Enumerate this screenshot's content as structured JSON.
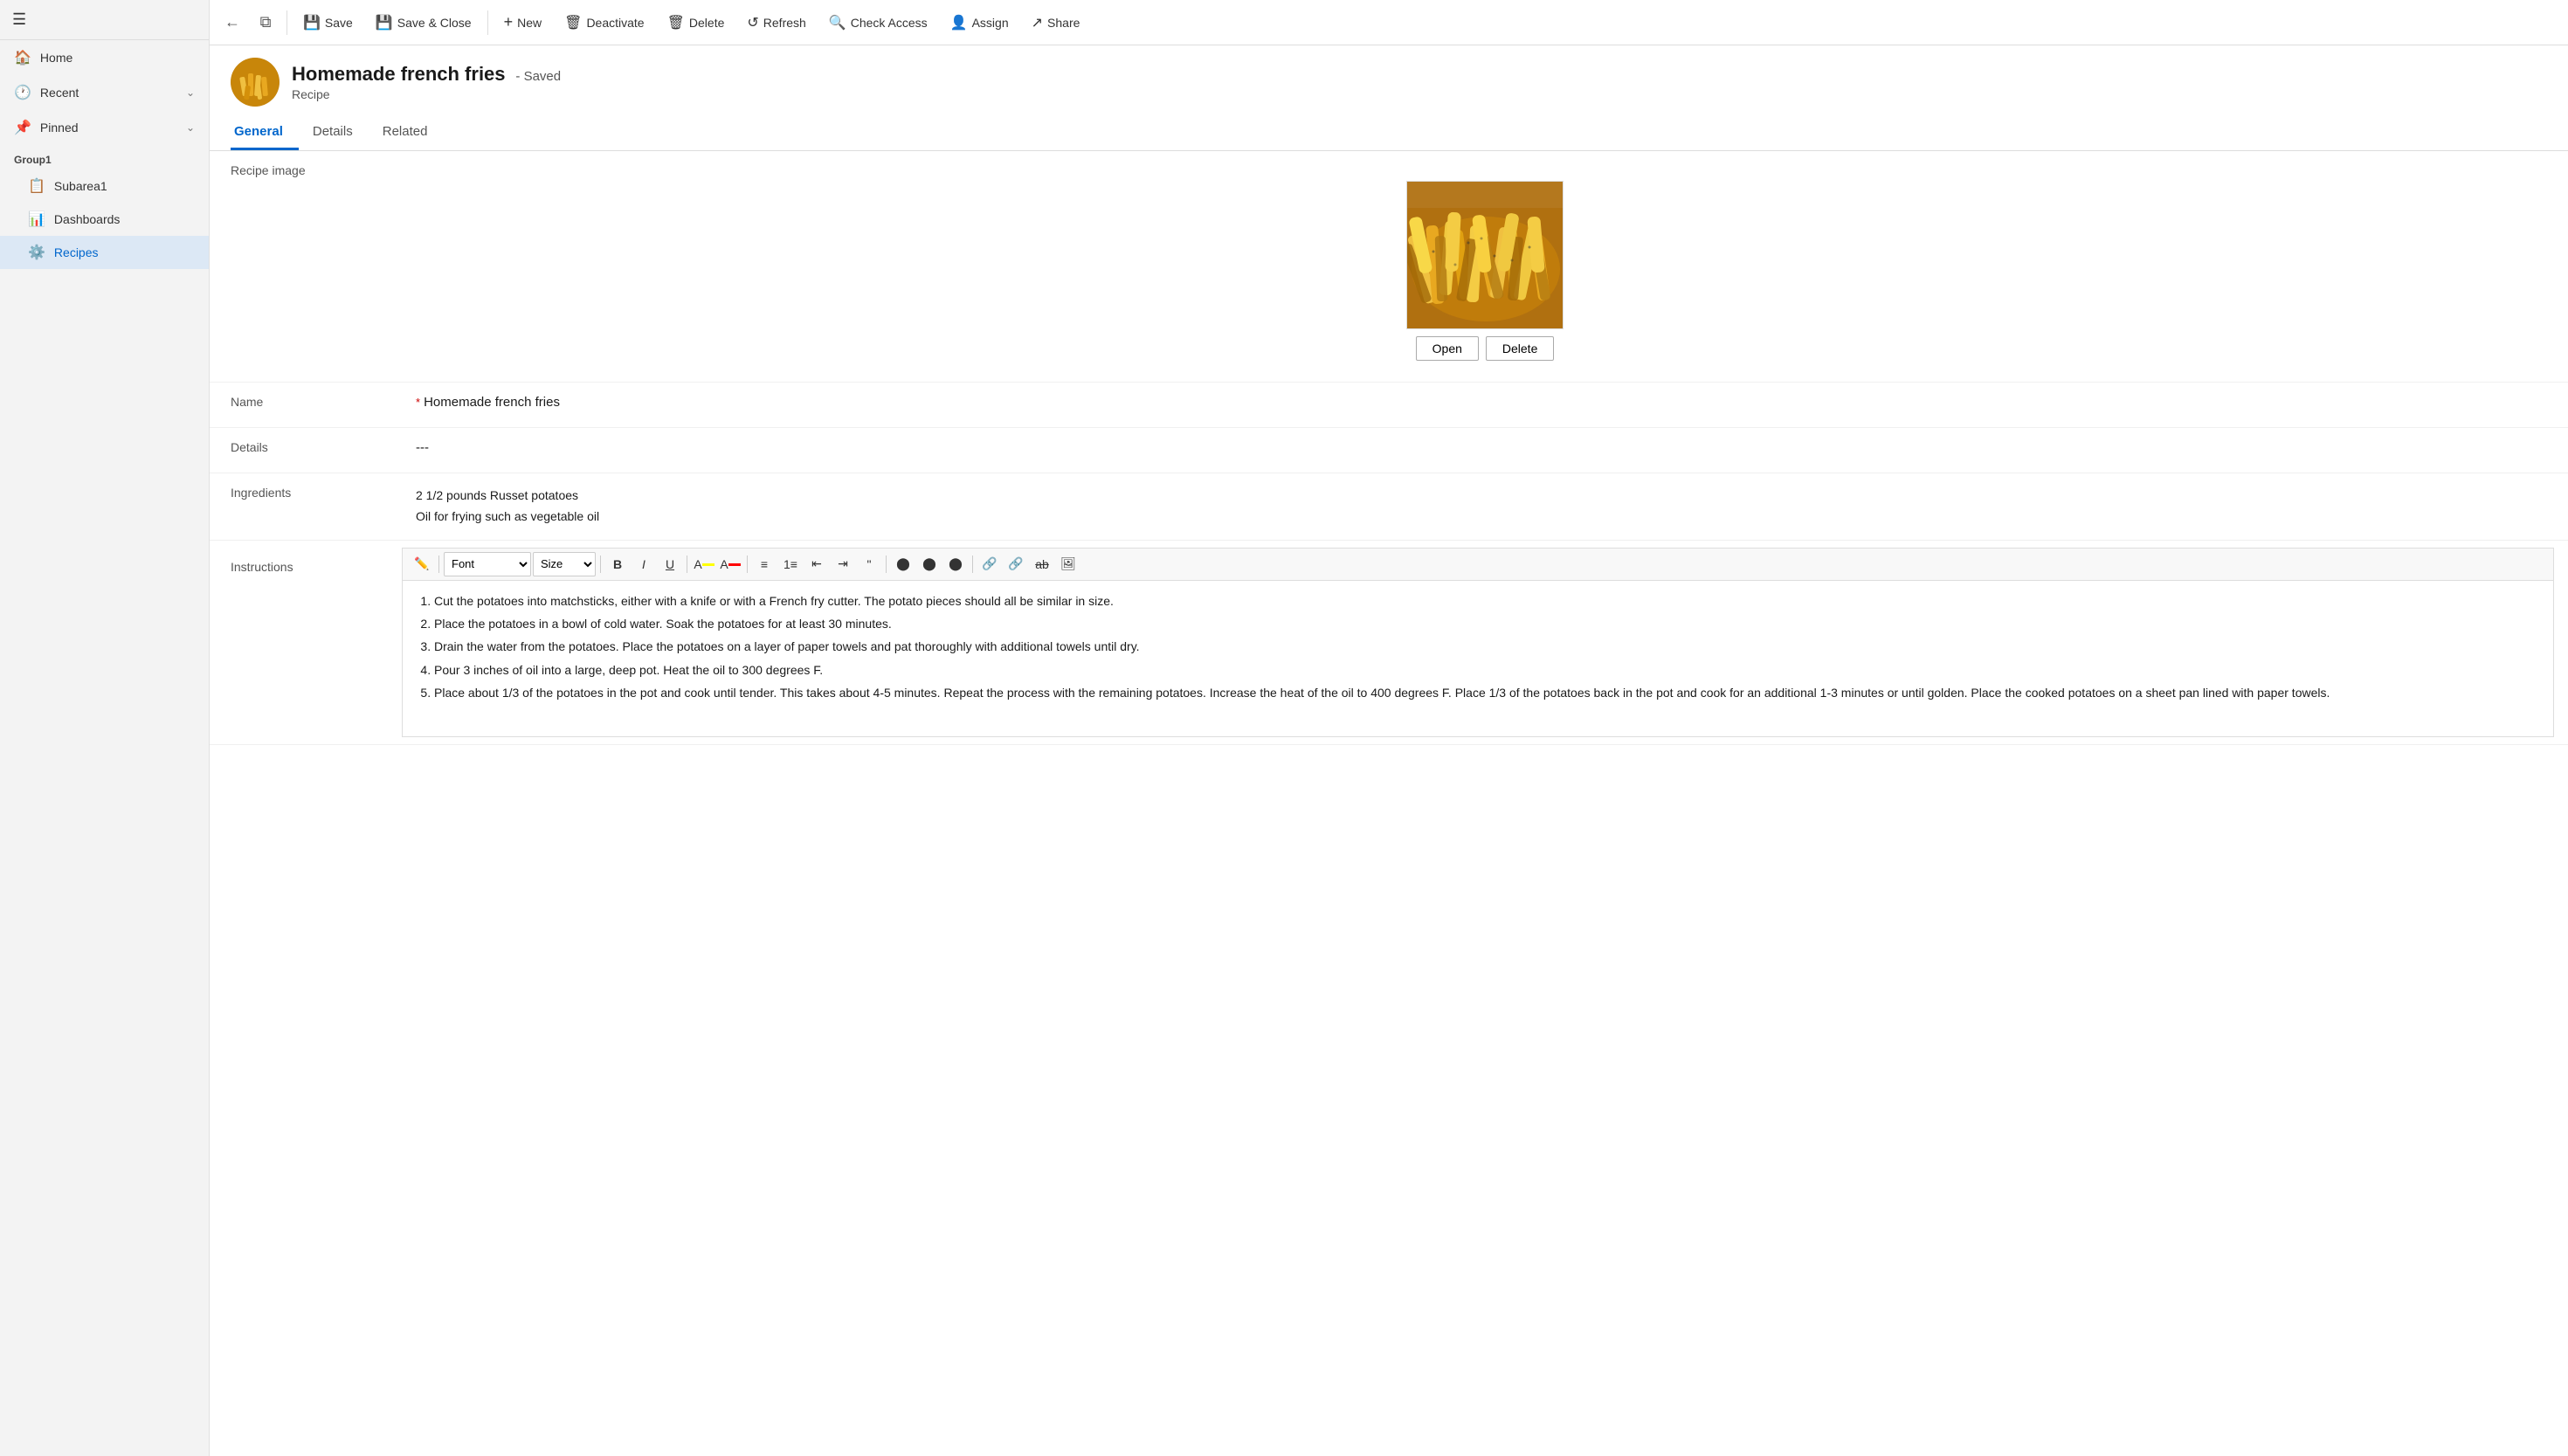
{
  "sidebar": {
    "menu_icon": "☰",
    "nav_items": [
      {
        "id": "home",
        "icon": "🏠",
        "label": "Home",
        "active": false
      },
      {
        "id": "recent",
        "icon": "🕐",
        "label": "Recent",
        "active": false,
        "has_arrow": true
      },
      {
        "id": "pinned",
        "icon": "📌",
        "label": "Pinned",
        "active": false,
        "has_arrow": true
      }
    ],
    "group_label": "Group1",
    "sub_items": [
      {
        "id": "subarea1",
        "icon": "📋",
        "label": "Subarea1",
        "active": false
      },
      {
        "id": "dashboards",
        "icon": "📊",
        "label": "Dashboards",
        "active": false
      },
      {
        "id": "recipes",
        "icon": "⚙️",
        "label": "Recipes",
        "active": true
      }
    ]
  },
  "toolbar": {
    "back_icon": "←",
    "open_icon": "⧉",
    "save_label": "Save",
    "save_icon": "💾",
    "save_close_label": "Save & Close",
    "save_close_icon": "💾",
    "new_label": "New",
    "new_icon": "+",
    "deactivate_label": "Deactivate",
    "deactivate_icon": "🗑",
    "delete_label": "Delete",
    "delete_icon": "🗑",
    "refresh_label": "Refresh",
    "refresh_icon": "↺",
    "check_access_label": "Check Access",
    "check_access_icon": "🔍",
    "assign_label": "Assign",
    "assign_icon": "👤",
    "share_label": "Share",
    "share_icon": "↗"
  },
  "record": {
    "title": "Homemade french fries",
    "saved_label": "- Saved",
    "type": "Recipe",
    "avatar_icon": "🍟"
  },
  "tabs": [
    {
      "id": "general",
      "label": "General",
      "active": true
    },
    {
      "id": "details",
      "label": "Details",
      "active": false
    },
    {
      "id": "related",
      "label": "Related",
      "active": false
    }
  ],
  "form": {
    "image_label": "Recipe image",
    "open_btn": "Open",
    "delete_btn": "Delete",
    "name_label": "Name",
    "name_required": "*",
    "name_value": "Homemade french fries",
    "details_label": "Details",
    "details_value": "---",
    "ingredients_label": "Ingredients",
    "ingredients_line1": "2 1/2 pounds Russet potatoes",
    "ingredients_line2": "Oil for frying such as vegetable oil",
    "instructions_label": "Instructions",
    "instructions_items": [
      "Cut the potatoes into matchsticks, either with a knife or with a French fry cutter. The potato pieces should all be similar in size.",
      "Place the potatoes in a bowl of cold water. Soak the potatoes for at least 30 minutes.",
      "Drain the water from the potatoes. Place the potatoes on a layer of paper towels and pat thoroughly with additional towels until dry.",
      "Pour 3 inches of oil into a large, deep pot. Heat the oil to 300 degrees F.",
      "Place about 1/3 of the potatoes in the pot and cook until tender. This takes about 4-5 minutes. Repeat the process with the remaining potatoes. Increase the heat of the oil to 400 degrees F. Place 1/3 of the potatoes back in the pot and cook for an additional 1-3 minutes or until golden. Place the cooked potatoes on a sheet pan lined with paper towels."
    ]
  },
  "rich_editor": {
    "font_label": "Font",
    "size_label": "Size",
    "bold": "B",
    "italic": "I",
    "underline": "U"
  }
}
